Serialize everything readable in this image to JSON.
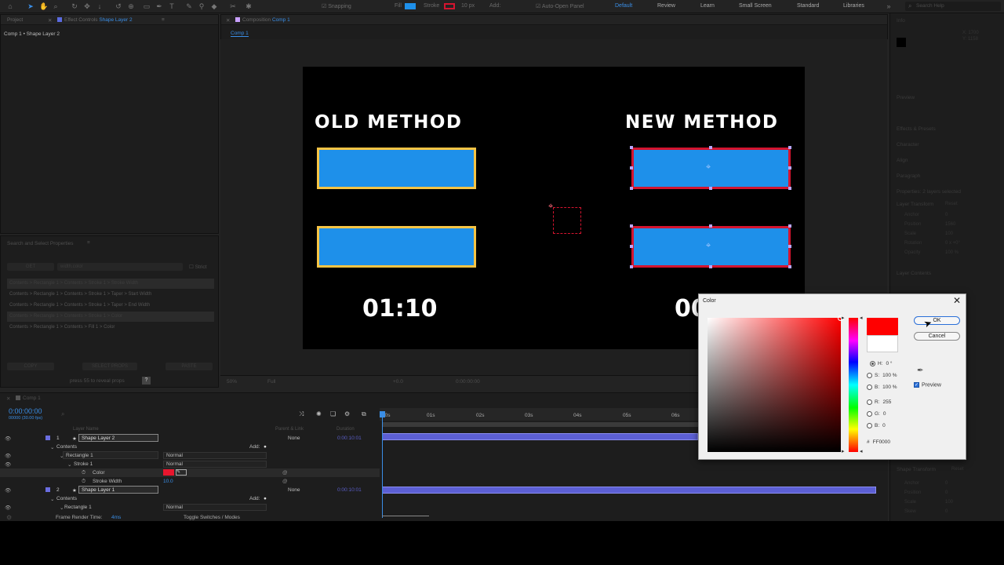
{
  "toolbar": {
    "snapping": "Snapping",
    "fill": "Fill",
    "stroke": "Stroke",
    "stroke_width": "10 px",
    "add": "Add:",
    "auto_open": "Auto-Open Panel",
    "workspaces": [
      "Default",
      "Review",
      "Learn",
      "Small Screen",
      "Standard",
      "Libraries"
    ],
    "search_placeholder": "Search Help"
  },
  "project_panel": {
    "tab_project": "Project",
    "tab_effect_controls": "Effect Controls",
    "effect_target": "Shape Layer 2",
    "breadcrumb": "Comp 1 • Shape Layer 2"
  },
  "search_panel": {
    "title": "Search and Select Properties",
    "get_button": "GET",
    "query": "width,color",
    "strict_label": "Strict",
    "results": [
      "Contents > Rectangle 1 > Contents > Stroke 1 > Stroke Width",
      "Contents > Rectangle 1 > Contents > Stroke 1 > Taper > Start Width",
      "Contents > Rectangle 1 > Contents > Stroke 1 > Taper > End Width",
      "Contents > Rectangle 1 > Contents > Stroke 1 > Color",
      "Contents > Rectangle 1 > Contents > Fill 1 > Color"
    ],
    "copy_button": "COPY",
    "select_props_button": "SELECT PROPS",
    "paste_button": "PASTE",
    "hint": "press 55 to reveal props"
  },
  "comp_panel": {
    "tab_label": "Composition",
    "comp_name": "Comp 1",
    "sub_tab": "Comp 1",
    "zoom": "50%",
    "resolution": "Full",
    "timecode": "0:00:00:00",
    "exposure": "+0.0"
  },
  "canvas": {
    "old_heading": "OLD METHOD",
    "new_heading": "NEW METHOD",
    "old_time": "01:10",
    "new_time": "00:19"
  },
  "timeline": {
    "tab": "Comp 1",
    "timecode": "0:00:00:00",
    "fps": "00000 (30.00 fps)",
    "col_layer_name": "Layer Name",
    "col_parent": "Parent & Link",
    "col_duration": "Duration",
    "ruler": [
      "00s",
      "01s",
      "02s",
      "03s",
      "04s",
      "05s",
      "06s"
    ],
    "layers": [
      {
        "num": "1",
        "name": "Shape Layer 2",
        "parent": "None",
        "duration": "0:00:10:01"
      },
      {
        "num": "2",
        "name": "Shape Layer 1",
        "parent": "None",
        "duration": "0:00:10:01"
      }
    ],
    "contents": "Contents",
    "add": "Add:",
    "rectangle": "Rectangle 1",
    "stroke": "Stroke 1",
    "color": "Color",
    "stroke_width": "Stroke Width",
    "stroke_width_val": "10.0",
    "blend_normal": "Normal",
    "render_time_label": "Frame Render Time:",
    "render_time_val": "4ms",
    "toggle_label": "Toggle Switches / Modes"
  },
  "right_panel": {
    "info": "Info",
    "coords_x": "X: 1700",
    "coords_y": "Y: 1158",
    "preview": "Preview",
    "effects_presets": "Effects & Presets",
    "character": "Character",
    "align": "Align",
    "paragraph": "Paragraph",
    "properties": "Properties: 2 layers selected",
    "layer_transform": "Layer Transform",
    "reset": "Reset",
    "props": [
      {
        "label": "Anchor",
        "value": "0"
      },
      {
        "label": "Position",
        "value": "1560"
      },
      {
        "label": "Scale",
        "value": "100"
      },
      {
        "label": "Rotation",
        "value": "0 x +0°"
      },
      {
        "label": "Opacity",
        "value": "100 %"
      }
    ],
    "layer_contents": "Layer Contents",
    "shape_transform": "Shape Transform",
    "shape_props": [
      {
        "label": "Anchor",
        "value": "0"
      },
      {
        "label": "Position",
        "value": "0"
      },
      {
        "label": "Scale",
        "value": "100"
      },
      {
        "label": "Skew",
        "value": "0"
      }
    ]
  },
  "color_dialog": {
    "title": "Color",
    "ok": "OK",
    "cancel": "Cancel",
    "h_label": "H:",
    "h_value": "0 °",
    "s_label": "S:",
    "s_value": "100 %",
    "b_label": "B:",
    "b_value": "100 %",
    "r_label": "R:",
    "r_value": "255",
    "g_label": "G:",
    "g_value": "0",
    "bl_label": "B:",
    "bl_value": "0",
    "hex_prefix": "#",
    "hex_value": "FF0000",
    "preview_label": "Preview",
    "new_color": "#ff0000",
    "old_color": "#ffffff"
  },
  "colors": {
    "accent": "#3a8ee6",
    "bar_fill": "#1e90ea",
    "old_stroke": "#f6c445",
    "new_stroke": "#d4142f",
    "track": "#5c5fd4"
  }
}
